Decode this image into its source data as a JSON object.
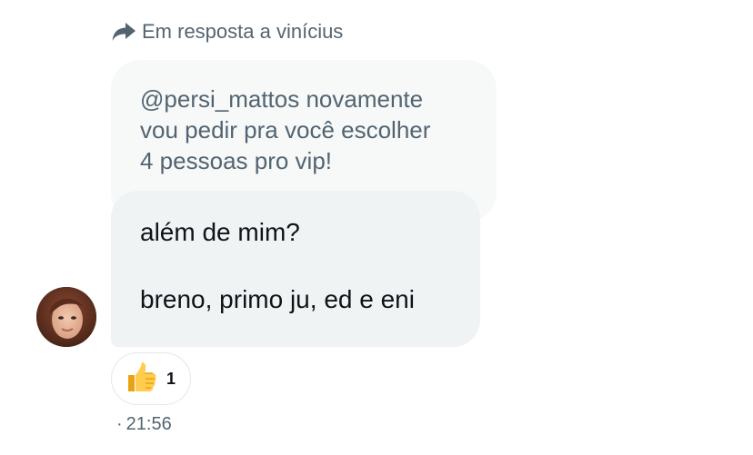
{
  "reply_header": {
    "icon": "reply-arrow-icon",
    "text": "Em resposta a vinícius"
  },
  "quoted_message": {
    "lines": [
      "@persi_mattos novamente",
      "vou pedir pra você escolher",
      "4 pessoas pro vip!"
    ]
  },
  "reply_message": {
    "lines": [
      "além de mim?",
      "breno, primo ju, ed e eni"
    ]
  },
  "reaction": {
    "emoji": "thumbs-up-icon",
    "count": "1"
  },
  "timestamp": {
    "separator": "·",
    "time": "21:56"
  },
  "colors": {
    "secondary_text": "#536471",
    "primary_text": "#0f1419",
    "quoted_bg": "#f7f9f9",
    "bubble_bg": "#eff3f4"
  }
}
